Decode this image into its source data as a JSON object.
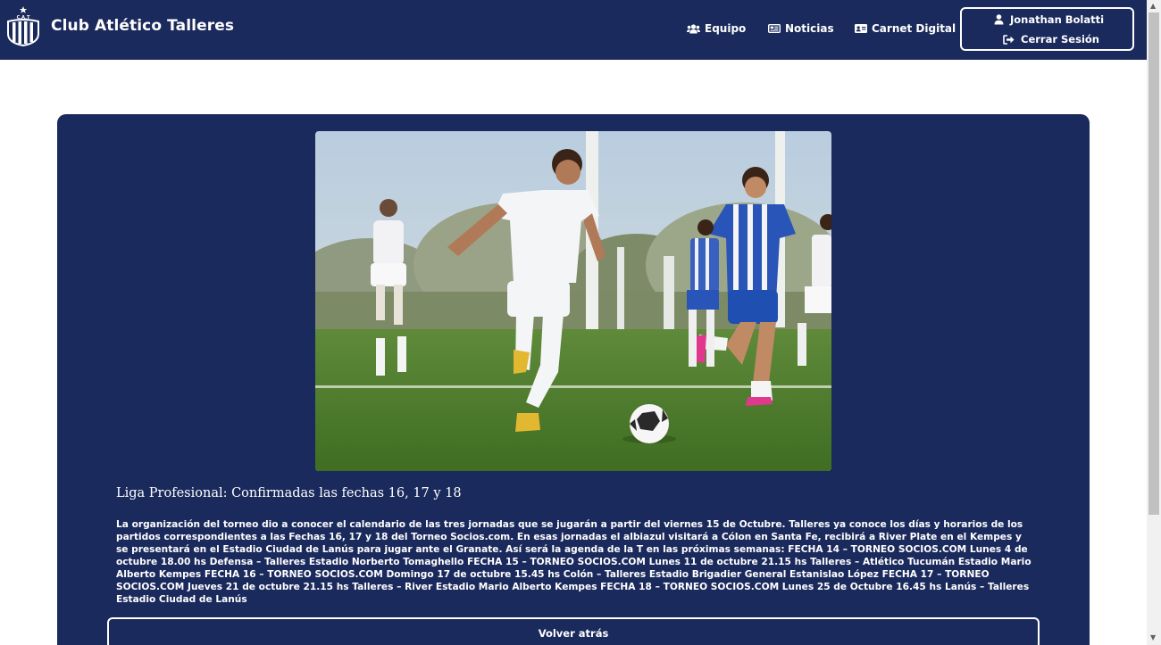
{
  "brand": {
    "title": "Club Atlético Talleres",
    "logo_text": "C.A.T"
  },
  "nav": {
    "items": [
      {
        "label": "Equipo",
        "icon": "users-icon"
      },
      {
        "label": "Noticias",
        "icon": "newspaper-icon"
      },
      {
        "label": "Carnet Digital",
        "icon": "id-card-icon"
      }
    ]
  },
  "user": {
    "name": "Jonathan Bolatti",
    "logout_label": "Cerrar Sesión"
  },
  "article": {
    "image_alt": "Jugadores de Talleres y Godoy Cruz disputando el balón",
    "title": "Liga Profesional: Confirmadas las fechas 16, 17 y 18",
    "body": "La organización del torneo dio a conocer el calendario de las tres jornadas que se jugarán a partir del viernes 15 de Octubre. Talleres ya conoce los días y horarios de los partidos correspondientes a las Fechas 16, 17 y 18 del Torneo Socios.com. En esas jornadas el albiazul visitará a Cólon en Santa Fe, recibirá a River Plate en el Kempes y se presentará en el Estadio Ciudad de Lanús para jugar ante el Granate. Así será la agenda de la T en las próximas semanas: FECHA 14 – TORNEO SOCIOS.COM Lunes 4 de octubre 18.00 hs Defensa – Talleres Estadio Norberto Tomaghello FECHA 15 – TORNEO SOCIOS.COM Lunes 11 de octubre 21.15 hs Talleres – Atlético Tucumán Estadio Mario Alberto Kempes FECHA 16 – TORNEO SOCIOS.COM Domingo 17 de octubre 15.45 hs Colón – Talleres Estadio Brigadier General Estanislao López FECHA 17 – TORNEO SOCIOS.COM Jueves 21 de octubre 21.15 hs Talleres – River Estadio Mario Alberto Kempes FECHA 18 – TORNEO SOCIOS.COM Lunes 25 de Octubre 16.45 hs Lanús – Talleres Estadio Ciudad de Lanús",
    "back_label": "Volver atrás"
  },
  "colors": {
    "navbar": "#1b2a5c",
    "card": "#1b2a5c",
    "text": "#ffffff",
    "page": "#ffffff"
  }
}
